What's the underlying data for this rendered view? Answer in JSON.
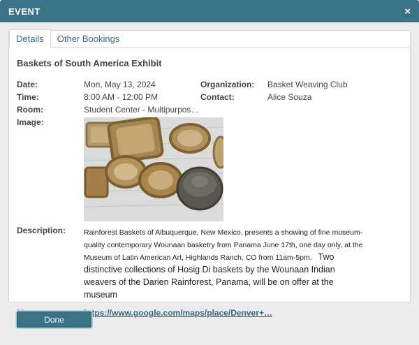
{
  "dialog": {
    "title": "EVENT",
    "close_glyph": "×"
  },
  "tabs": [
    {
      "label": "Details"
    },
    {
      "label": "Other Bookings"
    }
  ],
  "event": {
    "title": "Baskets of South America Exhibit",
    "date_label": "Date:",
    "date": "Mon, May 13, 2024",
    "time_label": "Time:",
    "time": "8:00 AM - 12:00 PM",
    "room_label": "Room:",
    "room": "Student Center - Multipurpos…",
    "org_label": "Organization:",
    "org": "Basket Weaving Club",
    "contact_label": "Contact:",
    "contact": "Alice Souza",
    "image_label": "Image:",
    "description_label": "Description:",
    "description_p1": "Rainforest Baskets of Albuquerque, New Mexico, presents a showing of fine museum-quality contemporary Wounaan basketry from Panama June 17th, one day only, at the Museum of Latin American Art, Highlands Ranch, CO from 11am-5pm.",
    "description_p2": "Two distinctive collections of Hosig Di baskets by the Wounaan Indian weavers of the Darien Rainforest, Panama, will be on offer at the museum",
    "map_label": "Map:",
    "map_link": "https://www.google.com/maps/place/Denver+…"
  },
  "footer": {
    "done_label": "Done"
  },
  "colors": {
    "accent": "#3a7387",
    "link": "#2f6c82"
  }
}
